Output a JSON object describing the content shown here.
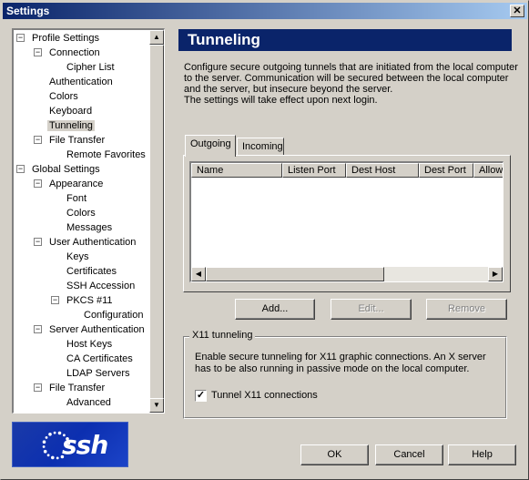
{
  "window": {
    "title": "Settings",
    "close_glyph": "✕"
  },
  "tree": {
    "items": [
      {
        "label": "Profile Settings"
      },
      {
        "label": "Connection"
      },
      {
        "label": "Cipher List"
      },
      {
        "label": "Authentication"
      },
      {
        "label": "Colors"
      },
      {
        "label": "Keyboard"
      },
      {
        "label": "Tunneling"
      },
      {
        "label": "File Transfer"
      },
      {
        "label": "Remote Favorites"
      },
      {
        "label": "Global Settings"
      },
      {
        "label": "Appearance"
      },
      {
        "label": "Font"
      },
      {
        "label": "Colors"
      },
      {
        "label": "Messages"
      },
      {
        "label": "User Authentication"
      },
      {
        "label": "Keys"
      },
      {
        "label": "Certificates"
      },
      {
        "label": "SSH Accession"
      },
      {
        "label": "PKCS #11"
      },
      {
        "label": "Configuration"
      },
      {
        "label": "Server Authentication"
      },
      {
        "label": "Host Keys"
      },
      {
        "label": "CA Certificates"
      },
      {
        "label": "LDAP Servers"
      },
      {
        "label": "File Transfer"
      },
      {
        "label": "Advanced"
      }
    ],
    "selected": "Tunneling"
  },
  "panel": {
    "title": "Tunneling",
    "description_lines": [
      "Configure secure outgoing tunnels that are initiated from the local computer",
      "to the server. Communication will be secured between the local computer",
      "and the server, but insecure beyond the server.",
      "The settings will take effect upon next login."
    ]
  },
  "tabs": [
    {
      "label": "Outgoing",
      "active": true
    },
    {
      "label": "Incoming",
      "active": false
    }
  ],
  "table": {
    "columns": [
      "Name",
      "Listen Port",
      "Dest Host",
      "Dest Port",
      "Allow"
    ],
    "rows": []
  },
  "buttons": {
    "add": "Add...",
    "edit": "Edit...",
    "remove": "Remove",
    "ok": "OK",
    "cancel": "Cancel",
    "help": "Help"
  },
  "x11": {
    "legend": "X11 tunneling",
    "description_lines": [
      "Enable secure tunneling for X11 graphic connections. An X server",
      "has to be also running in passive mode on the local computer."
    ],
    "checkbox_label": "Tunnel X11 connections",
    "checked": true,
    "check_glyph": "✓"
  },
  "logo": {
    "text": "ssh"
  },
  "scroll_glyphs": {
    "up": "▲",
    "down": "▼",
    "left": "◀",
    "right": "▶"
  }
}
